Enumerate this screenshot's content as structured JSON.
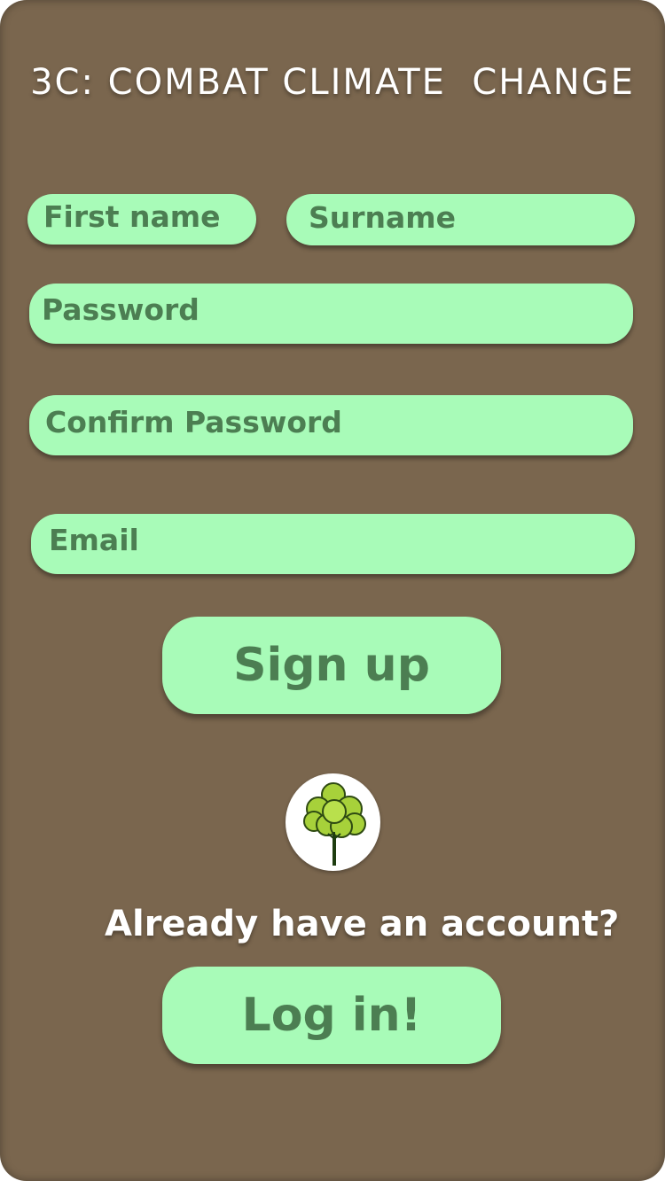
{
  "app": {
    "title": "3C: COMBAT CLIMATE  CHANGE"
  },
  "form": {
    "first_name_placeholder": "First name",
    "surname_placeholder": "Surname",
    "password_placeholder": "Password",
    "confirm_password_placeholder": "Confirm Password",
    "email_placeholder": "Email"
  },
  "actions": {
    "signup_label": "Sign up",
    "login_prompt": "Already have an account?",
    "login_label": "Log in!"
  },
  "logo": {
    "icon": "tree-icon"
  },
  "colors": {
    "background": "#7a664e",
    "field": "#a8fbb8",
    "field_text": "#4c7e52",
    "title_text": "#ffffff"
  }
}
